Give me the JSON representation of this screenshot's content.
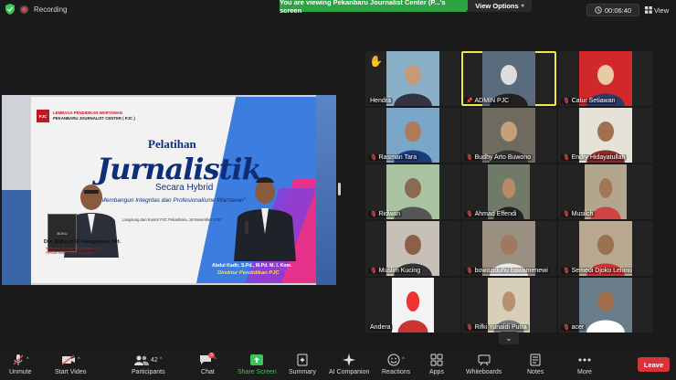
{
  "topbar": {
    "recording_label": "Recording",
    "viewing_banner": "You are viewing Pekanbaru Journalist Center (P...'s screen",
    "view_options": "View Options",
    "timer": "00:06:40",
    "view_label": "View"
  },
  "shared_slide": {
    "org_line1": "LEMBAGA PENDIDIKAN WARTAWAN",
    "org_line2": "PEKANBARU JOURNALIST CENTER ( PJC )",
    "logo": "PJC",
    "pelatihan": "Pelatihan",
    "jurnalistik": "Jurnalistik",
    "secara_hybrid": "Secara Hybrid",
    "tagline": "\"Membangun Integritas dan Profesionalisme Wartawan\"",
    "location": "Langsung dari Kantor PJC Pekanbaru, 18 November 2023",
    "speaker1_name": "Drs. Wahyudi El Panggabean, MH.",
    "speaker1_role": "Instruktur Jurnalis Berpengalaman / Penulis Buku - Buku Jurnalistik",
    "speaker2_name": "Abdul Kadir, S.Pd., M.Pd. M. I. Kom.",
    "speaker2_role": "Direktur Pendidikan PJC",
    "book_label": "BUKU"
  },
  "participants": [
    {
      "name": "Hendra",
      "muted": false,
      "hand": true
    },
    {
      "name": "ADMIN PJC",
      "muted": false,
      "active": true
    },
    {
      "name": "Catur Setiawan",
      "muted": true
    },
    {
      "name": "Rasman Tara",
      "muted": true
    },
    {
      "name": "Budhy Arto Buwono",
      "muted": true
    },
    {
      "name": "Endry Hidayatullah",
      "muted": true
    },
    {
      "name": "Ridwan",
      "muted": true
    },
    {
      "name": "Ahmad Effendi",
      "muted": true
    },
    {
      "name": "Musilch",
      "muted": true
    },
    {
      "name": "Muslim Kucing",
      "muted": true
    },
    {
      "name": "bowoziduhu bawamenewi",
      "muted": true
    },
    {
      "name": "Semedi Djoko Lelono",
      "muted": true
    },
    {
      "name": "Andera",
      "muted": false
    },
    {
      "name": "Rifki Yunaldi Putra",
      "muted": true
    },
    {
      "name": "acer",
      "muted": true
    }
  ],
  "toolbar": {
    "unmute": "Unmute",
    "start_video": "Start Video",
    "participants": "Participants",
    "participants_count": "42",
    "chat": "Chat",
    "chat_badge": "3",
    "share_screen": "Share Screen",
    "summary": "Summary",
    "ai_companion": "AI Companion",
    "reactions": "Reactions",
    "apps": "Apps",
    "whiteboards": "Whiteboards",
    "notes": "Notes",
    "more": "More",
    "leave": "Leave"
  },
  "colors": {
    "recording_green": "#2ea343",
    "leave_red": "#d8333a",
    "mute_red": "#e5484d",
    "active_outline": "#f0e74d"
  }
}
